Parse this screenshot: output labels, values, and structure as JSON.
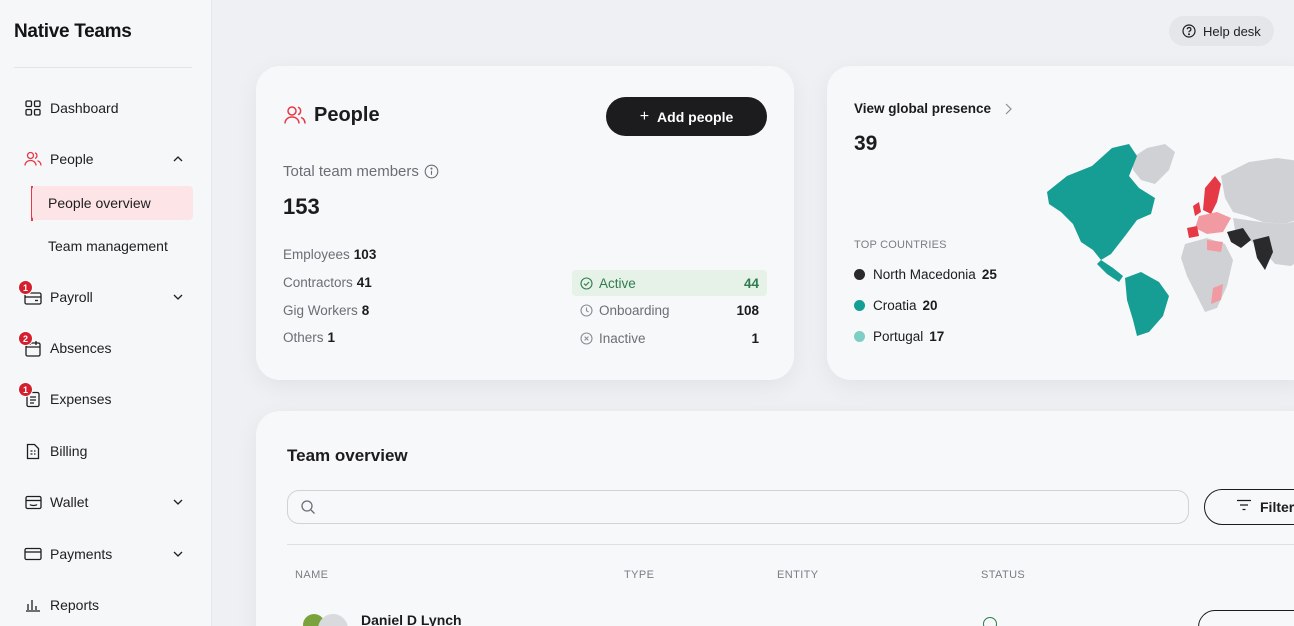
{
  "brand": {
    "logo": "Native Teams"
  },
  "sidebar": {
    "items": [
      {
        "label": "Dashboard",
        "icon": "dashboard-grid-icon"
      },
      {
        "label": "People",
        "icon": "people-icon",
        "expanded": true
      },
      {
        "label": "People overview",
        "sub": true,
        "active": true
      },
      {
        "label": "Team management",
        "sub": true
      },
      {
        "label": "Payroll",
        "icon": "payroll-icon",
        "badge": "1"
      },
      {
        "label": "Absences",
        "icon": "absences-icon",
        "badge": "2"
      },
      {
        "label": "Expenses",
        "icon": "expenses-icon",
        "badge": "1"
      },
      {
        "label": "Billing",
        "icon": "billing-icon"
      },
      {
        "label": "Wallet",
        "icon": "wallet-icon"
      },
      {
        "label": "Payments",
        "icon": "payments-icon"
      },
      {
        "label": "Reports",
        "icon": "reports-icon"
      }
    ]
  },
  "header": {
    "help_desk": "Help desk"
  },
  "people_card": {
    "title": "People",
    "add_button": "Add people",
    "total_label": "Total team members",
    "total_value": "153",
    "types": [
      {
        "label": "Employees",
        "value": "103"
      },
      {
        "label": "Contractors",
        "value": "41"
      },
      {
        "label": "Gig Workers",
        "value": "8"
      },
      {
        "label": "Others",
        "value": "1"
      }
    ],
    "statuses": [
      {
        "label": "Active",
        "value": "44"
      },
      {
        "label": "Onboarding",
        "value": "108"
      },
      {
        "label": "Inactive",
        "value": "1"
      }
    ]
  },
  "global_card": {
    "link": "View global presence",
    "count": "39",
    "top_label": "TOP COUNTRIES",
    "countries": [
      {
        "name": "North Macedonia",
        "value": "25",
        "color": "#2a2a2c"
      },
      {
        "name": "Croatia",
        "value": "20",
        "color": "#169e94"
      },
      {
        "name": "Portugal",
        "value": "17",
        "color": "#7fcdc3"
      }
    ]
  },
  "team_overview": {
    "title": "Team overview",
    "search_placeholder": "",
    "filter": "Filter",
    "columns": [
      "NAME",
      "TYPE",
      "ENTITY",
      "STATUS"
    ],
    "rows": [
      {
        "name": "Daniel D Lynch"
      }
    ]
  },
  "colors": {
    "accent_red": "#e63946",
    "teal": "#169e94",
    "dark": "#1c1c1e",
    "active_green": "#2e7d4f"
  }
}
